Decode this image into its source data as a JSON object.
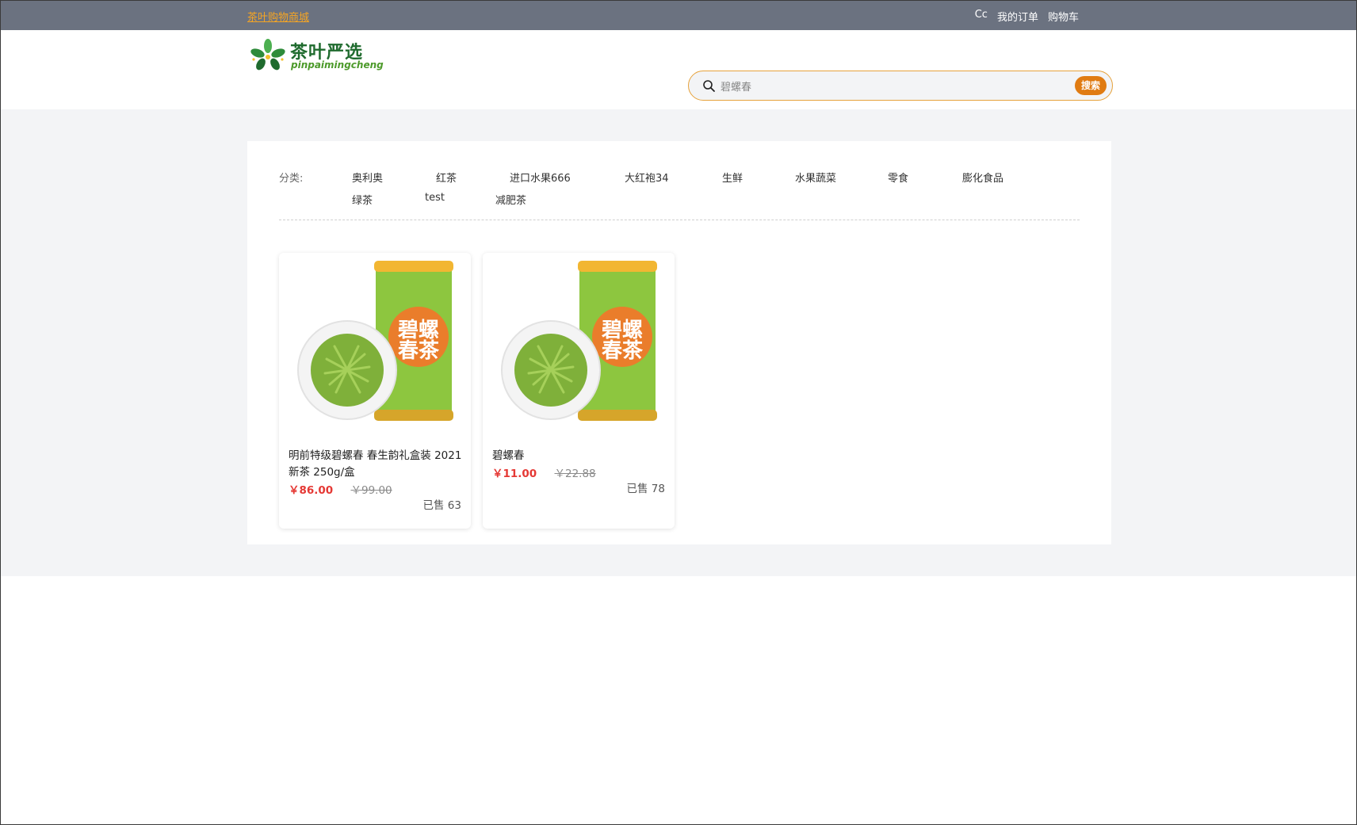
{
  "topbar": {
    "brand_link": "茶叶购物商城",
    "user": "Cc",
    "orders": "我的订单",
    "cart": "购物车"
  },
  "header": {
    "logo_title": "茶叶严选",
    "logo_sub": "pinpaimingcheng"
  },
  "search": {
    "value": "碧螺春",
    "button": "搜索",
    "icon": "search-icon"
  },
  "categories": {
    "label": "分类:",
    "items": [
      "奥利奥",
      "红茶",
      "进口水果666",
      "大红袍34",
      "生鲜",
      "水果蔬菜",
      "零食",
      "膨化食品",
      "绿茶",
      "test",
      "减肥茶"
    ]
  },
  "products": [
    {
      "name": "明前特级碧螺春 春生韵礼盒装 2021新茶 250g/盒",
      "price": "￥86.00",
      "original_price": "￥99.00",
      "sold": "已售 63"
    },
    {
      "name": "碧螺春",
      "price": "￥11.00",
      "original_price": "￥22.88",
      "sold": "已售 78"
    }
  ],
  "colors": {
    "topbar": "#6b7280",
    "accent": "#e07b12",
    "price": "#e53935",
    "brand_link": "#f5a524"
  }
}
